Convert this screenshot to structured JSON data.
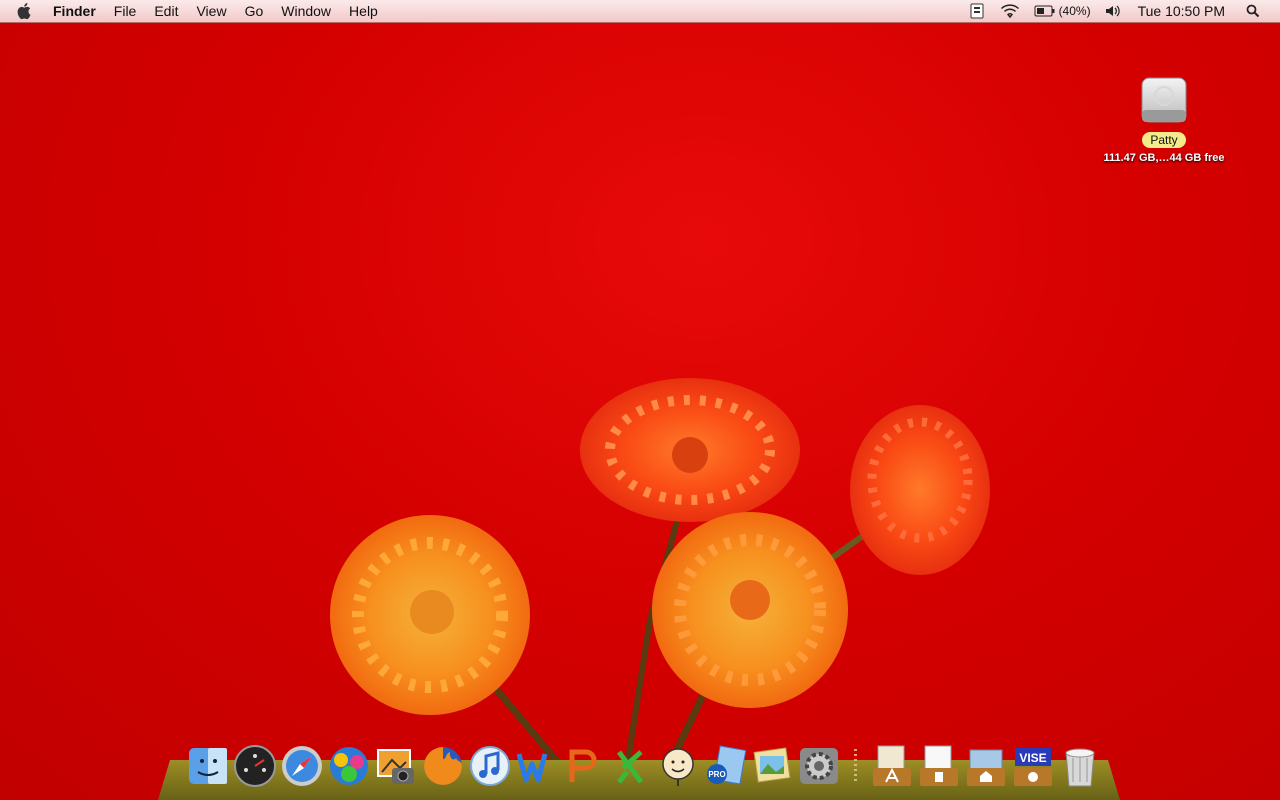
{
  "menubar": {
    "app_name": "Finder",
    "menus": [
      "File",
      "Edit",
      "View",
      "Go",
      "Window",
      "Help"
    ],
    "status": {
      "battery_percent": "(40%)",
      "clock": "Tue 10:50 PM"
    }
  },
  "desktop": {
    "disk": {
      "name": "Patty",
      "info": "111.47 GB,…44 GB free"
    }
  },
  "dock": {
    "apps": [
      "finder-icon",
      "dashboard-icon",
      "safari-icon",
      "colorful-app-icon",
      "iphoto-icon",
      "firefox-icon",
      "itunes-icon",
      "word-icon",
      "powerpoint-icon",
      "excel-icon",
      "face-app-icon",
      "pro-app-icon",
      "image-viewer-icon",
      "system-preferences-icon"
    ],
    "folders": [
      "applications-folder-icon",
      "documents-folder-icon",
      "home-folder-icon",
      "vise-folder-icon",
      "trash-icon"
    ],
    "vise_label": "VISE",
    "pro_label": "PRO"
  },
  "colors": {
    "desktop_red": "#d50000",
    "menubar_pink": "#f2c9c9",
    "disk_label_yellow": "#f3ea8a"
  }
}
